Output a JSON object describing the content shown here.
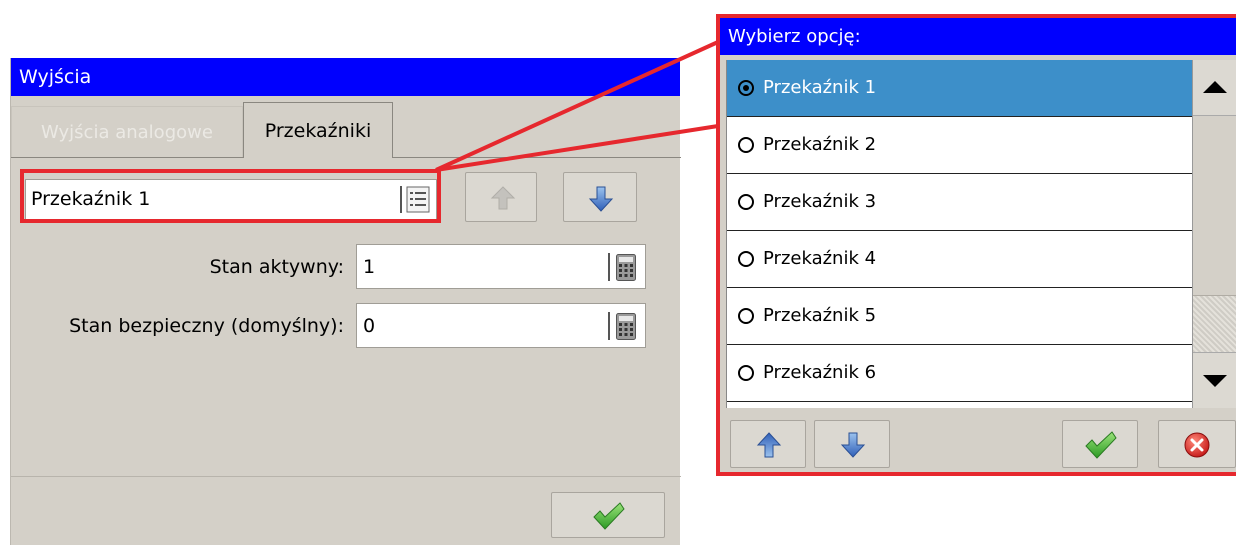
{
  "left_window": {
    "title": "Wyjścia",
    "tabs": [
      {
        "label": "Wyjścia analogowe",
        "active": false
      },
      {
        "label": "Przekaźniki",
        "active": true
      }
    ],
    "relay_select": {
      "value": "Przekaźnik 1",
      "icon": "list-icon"
    },
    "fields": [
      {
        "label": "Stan aktywny:",
        "value": "1",
        "icon": "calculator-icon"
      },
      {
        "label": "Stan bezpieczny (domyślny):",
        "value": "0",
        "icon": "calculator-icon"
      }
    ],
    "buttons": {
      "up": "arrow-up-icon",
      "down": "arrow-down-icon",
      "ok": "checkmark-icon"
    }
  },
  "dialog": {
    "title": "Wybierz opcję:",
    "options": [
      {
        "label": "Przekaźnik 1",
        "selected": true
      },
      {
        "label": "Przekaźnik 2",
        "selected": false
      },
      {
        "label": "Przekaźnik 3",
        "selected": false
      },
      {
        "label": "Przekaźnik 4",
        "selected": false
      },
      {
        "label": "Przekaźnik 5",
        "selected": false
      },
      {
        "label": "Przekaźnik 6",
        "selected": false
      }
    ],
    "buttons": {
      "up": "arrow-up-icon",
      "down": "arrow-down-icon",
      "ok": "checkmark-icon",
      "cancel": "cancel-icon"
    }
  },
  "colors": {
    "titlebar": "#0000fe",
    "highlight": "#e6282e",
    "selection": "#3d8fc9",
    "window_bg": "#d4d0c8"
  }
}
